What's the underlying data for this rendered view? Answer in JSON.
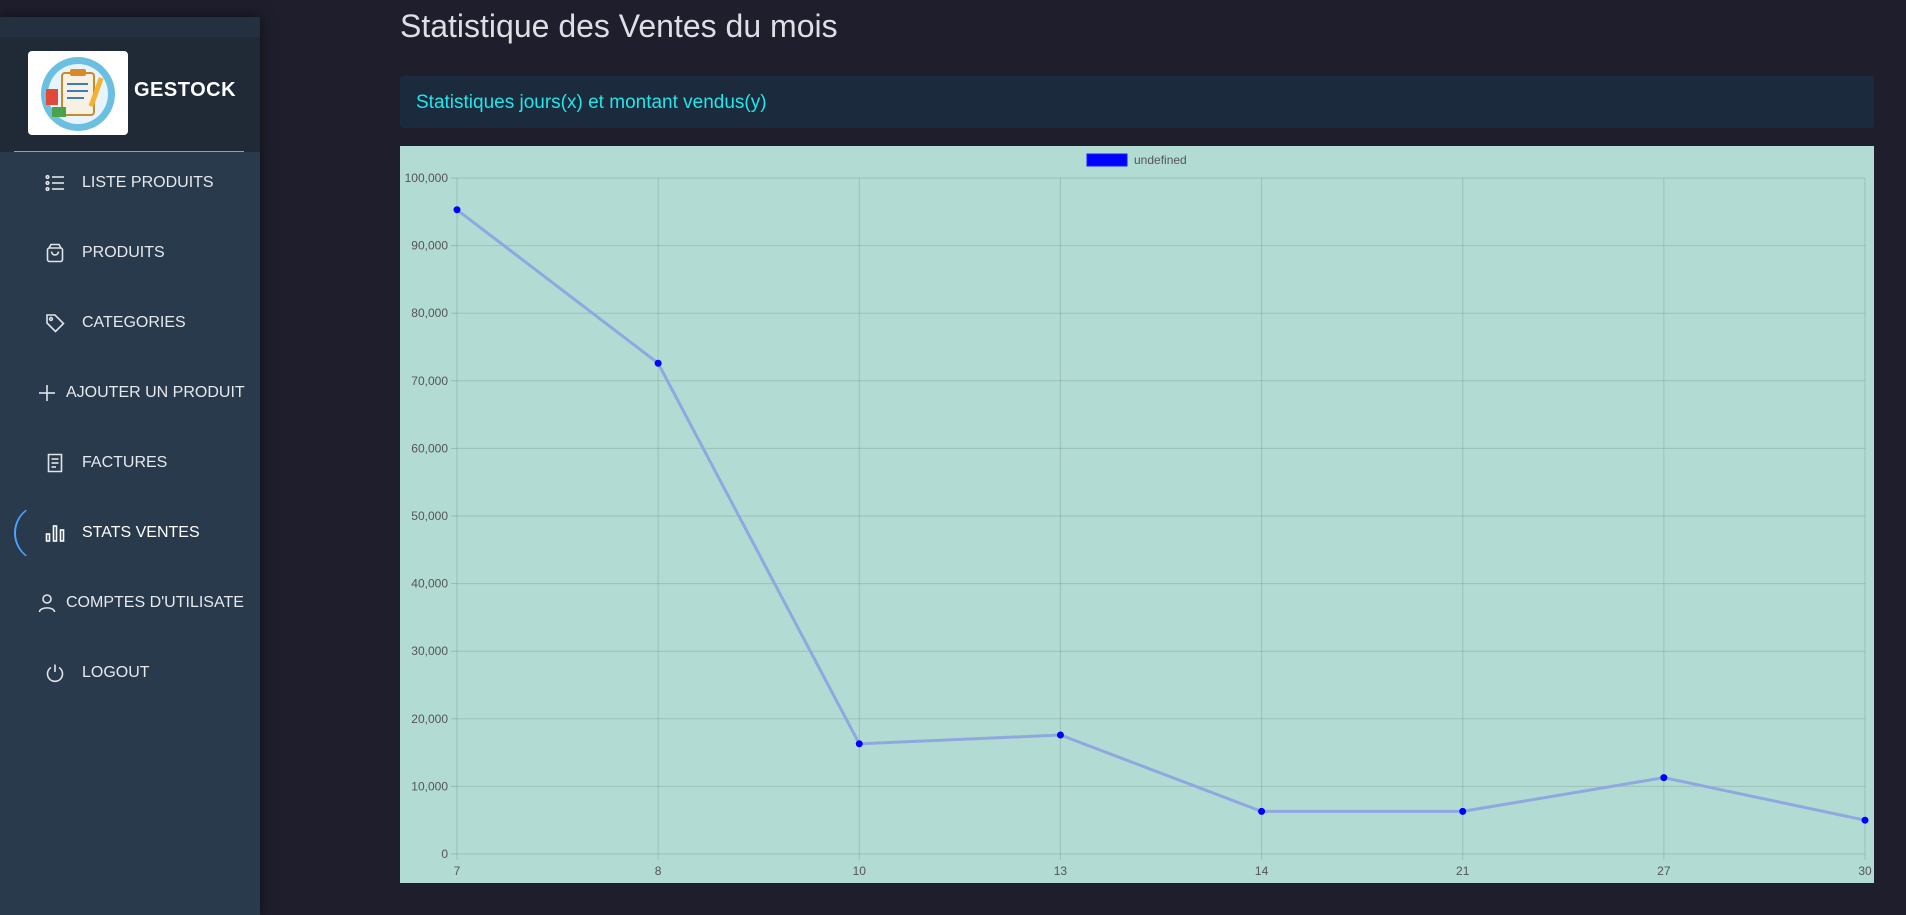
{
  "app": {
    "name": "GESTOCK"
  },
  "sidebar": {
    "items": [
      {
        "label": "LISTE PRODUITS",
        "icon": "list-icon",
        "active": false
      },
      {
        "label": "PRODUITS",
        "icon": "shopping-bag-icon",
        "active": false
      },
      {
        "label": "CATEGORIES",
        "icon": "tag-icon",
        "active": false
      },
      {
        "label": "AJOUTER UN PRODUIT",
        "icon": "plus-icon",
        "active": false
      },
      {
        "label": "FACTURES",
        "icon": "receipt-icon",
        "active": false
      },
      {
        "label": "STATS VENTES",
        "icon": "bar-chart-icon",
        "active": true
      },
      {
        "label": "COMPTES D'UTILISATE",
        "icon": "user-icon",
        "active": false
      },
      {
        "label": "LOGOUT",
        "icon": "power-icon",
        "active": false
      }
    ]
  },
  "main": {
    "title": "Statistique des Ventes du mois",
    "card_title": "Statistiques jours(x) et montant vendus(y)"
  },
  "colors": {
    "accent": "#21e6ea",
    "line": "#8fa9e0",
    "point": "#0000ff",
    "chart_bg": "#b2dbd3"
  },
  "chart_data": {
    "type": "line",
    "categories": [
      "7",
      "8",
      "10",
      "13",
      "14",
      "21",
      "27",
      "30"
    ],
    "series": [
      {
        "name": "undefined",
        "values": [
          95300,
          72600,
          16300,
          17600,
          6300,
          6300,
          11300,
          5000
        ]
      }
    ],
    "ylim": [
      0,
      100000
    ],
    "yticks": [
      "0",
      "10,000",
      "20,000",
      "30,000",
      "40,000",
      "50,000",
      "60,000",
      "70,000",
      "80,000",
      "90,000",
      "100,000"
    ],
    "grid": true,
    "legend": "top"
  }
}
